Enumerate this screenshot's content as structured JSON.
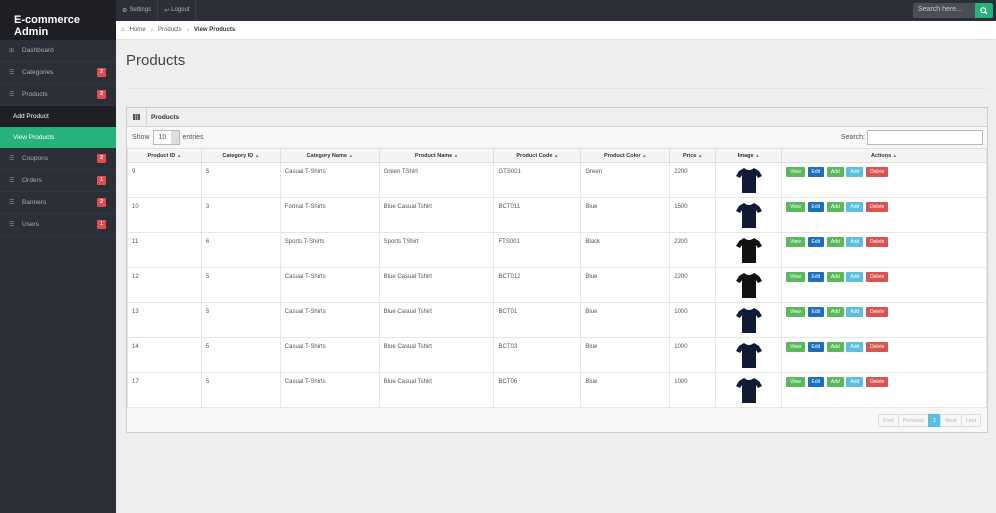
{
  "app": {
    "title": "E-commerce Admin"
  },
  "topnav": [
    {
      "icon": "gear-icon",
      "glyph": "⚙",
      "label": "Settings"
    },
    {
      "icon": "logout-icon",
      "glyph": "↩",
      "label": "Logout"
    }
  ],
  "search": {
    "placeholder": "Search here..."
  },
  "sidebar": {
    "items": [
      {
        "label": "Dashboard",
        "badge": ""
      },
      {
        "label": "Categories",
        "badge": "2"
      },
      {
        "label": "Products",
        "badge": "2"
      }
    ],
    "subitems": [
      {
        "label": "Add Product"
      },
      {
        "label": "View Products"
      }
    ],
    "items2": [
      {
        "label": "Coupons",
        "badge": "2"
      },
      {
        "label": "Orders",
        "badge": "1"
      },
      {
        "label": "Banners",
        "badge": "2"
      },
      {
        "label": "Users",
        "badge": "1"
      }
    ]
  },
  "breadcrumb": {
    "home": "Home",
    "products": "Products",
    "current": "View Products"
  },
  "page": {
    "title": "Products"
  },
  "widget": {
    "title": "Products"
  },
  "controls": {
    "show": "Show",
    "entries_value": "10",
    "entries": "entries",
    "search": "Search:"
  },
  "table": {
    "headers": [
      "Product ID",
      "Category ID",
      "Category Name",
      "Product Name",
      "Product Code",
      "Product Color",
      "Price",
      "Image",
      "Actions"
    ],
    "rows": [
      [
        "9",
        "5",
        "Casual T-Shirts",
        "Green TShirt",
        "GTS001",
        "Green",
        "2200"
      ],
      [
        "10",
        "3",
        "Formal T-Shirts",
        "Blue Casual Tshirt",
        "BCT011",
        "Blue",
        "1500"
      ],
      [
        "11",
        "6",
        "Sports T-Shirts",
        "Sports TShirt",
        "FTS001",
        "Black",
        "2200"
      ],
      [
        "12",
        "5",
        "Casual T-Shirts",
        "Blue Casual Tshirt",
        "BCT012",
        "Blue",
        "2200"
      ],
      [
        "13",
        "5",
        "Casual T-Shirts",
        "Blue Casual Tshirt",
        "BCT01",
        "Blue",
        "1000"
      ],
      [
        "14",
        "5",
        "Casual T-Shirts",
        "Blue Casual Tshirt",
        "BCT03",
        "Blue",
        "1000"
      ],
      [
        "17",
        "5",
        "Casual T-Shirts",
        "Blue Casual Tshirt",
        "BCT06",
        "Blue",
        "1000"
      ]
    ],
    "shirt_colors": [
      "#0f1a35",
      "#0f1a35",
      "#111111",
      "#121212",
      "#0f1a35",
      "#0f1a35",
      "#0f1a35"
    ],
    "actions": {
      "view": "View",
      "edit": "Edit",
      "add": "Add",
      "delete": "Delete"
    }
  },
  "pager": {
    "first": "First",
    "previous": "Previous",
    "page": "1",
    "next": "Next",
    "last": "Last"
  },
  "colors": {
    "accent": "#27b27a",
    "badge": "#e24c4c",
    "sidebar": "#2b2f38"
  }
}
